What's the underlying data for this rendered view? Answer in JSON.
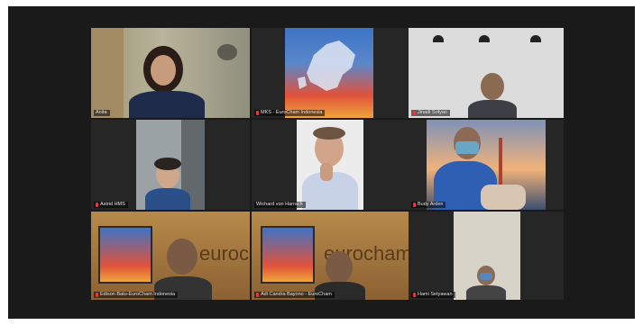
{
  "participants": [
    {
      "name": "Anita",
      "mic_muted": false
    },
    {
      "name": "MKS - EuroCham Indonesia",
      "mic_muted": true
    },
    {
      "name": "Jinadi Sofyan",
      "mic_muted": true
    },
    {
      "name": "Astrid HMS",
      "mic_muted": true
    },
    {
      "name": "Wichard von Harrach",
      "mic_muted": false
    },
    {
      "name": "Budy Arden",
      "mic_muted": true
    },
    {
      "name": "Edison Batu-EuroCham Indonesia",
      "mic_muted": true
    },
    {
      "name": "Adi Candra Bayono - EuroCham",
      "mic_muted": true
    },
    {
      "name": "Hami Setyawan",
      "mic_muted": true
    }
  ],
  "background_text": {
    "eurocham_1": "eurocham",
    "eurocham_2": "eurocham"
  },
  "colors": {
    "active_speaker": "#d8e05a",
    "muted_mic": "#e03b3b",
    "frame_bg": "#1a1a1a"
  }
}
